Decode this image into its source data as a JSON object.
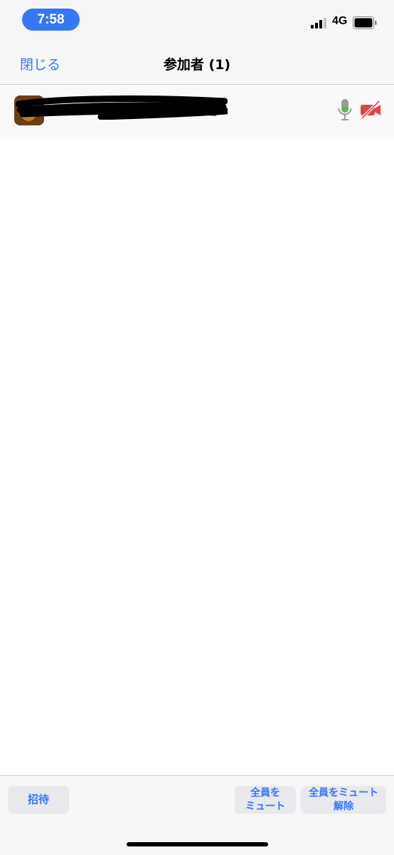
{
  "status_bar": {
    "time": "7:58",
    "network": "4G",
    "accent_color": "#3478f6"
  },
  "nav": {
    "close_label": "閉じる",
    "title": "参加者 (1)"
  },
  "participants": [
    {
      "name": "",
      "mic_icon": "microphone-icon",
      "mic_color": "#5cb85c",
      "video_icon": "video-off-icon",
      "video_color": "#e0434a"
    }
  ],
  "toolbar": {
    "invite_label": "招待",
    "mute_all_label": "全員を\nミュート",
    "unmute_all_label": "全員をミュート\n解除"
  }
}
